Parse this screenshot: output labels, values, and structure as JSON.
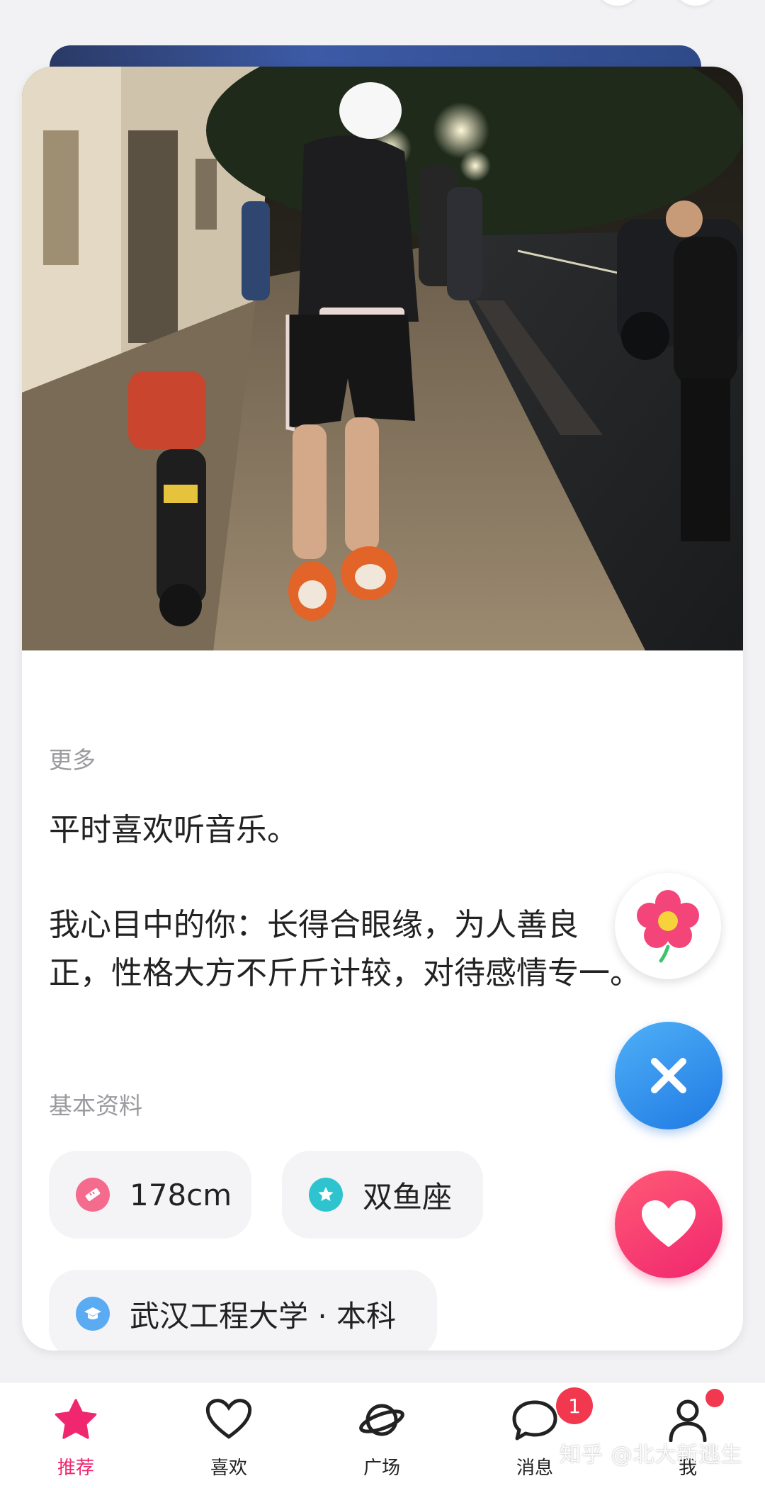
{
  "profile": {
    "more_label": "更多",
    "bio_line1": "平时喜欢听音乐。",
    "bio_line2": "我心目中的你：长得合眼缘，为人善良\n正，性格大方不斤斤计较，对待感情专一。",
    "basic_label": "基本资料",
    "height": "178cm",
    "zodiac": "双鱼座",
    "education": "武汉工程大学 · 本科"
  },
  "nav": {
    "items": [
      {
        "label": "推荐",
        "icon": "star-icon",
        "active": true
      },
      {
        "label": "喜欢",
        "icon": "heart-outline-icon",
        "active": false
      },
      {
        "label": "广场",
        "icon": "planet-icon",
        "active": false
      },
      {
        "label": "消息",
        "icon": "chat-bubble-icon",
        "active": false
      },
      {
        "label": "我",
        "icon": "person-icon",
        "active": false
      }
    ],
    "message_badge": "1"
  },
  "watermark": "知乎 @北大新逃生",
  "colors": {
    "accent_pink": "#f0266e",
    "pass_blue": "#1f7ae3",
    "badge_red": "#f2384f"
  }
}
